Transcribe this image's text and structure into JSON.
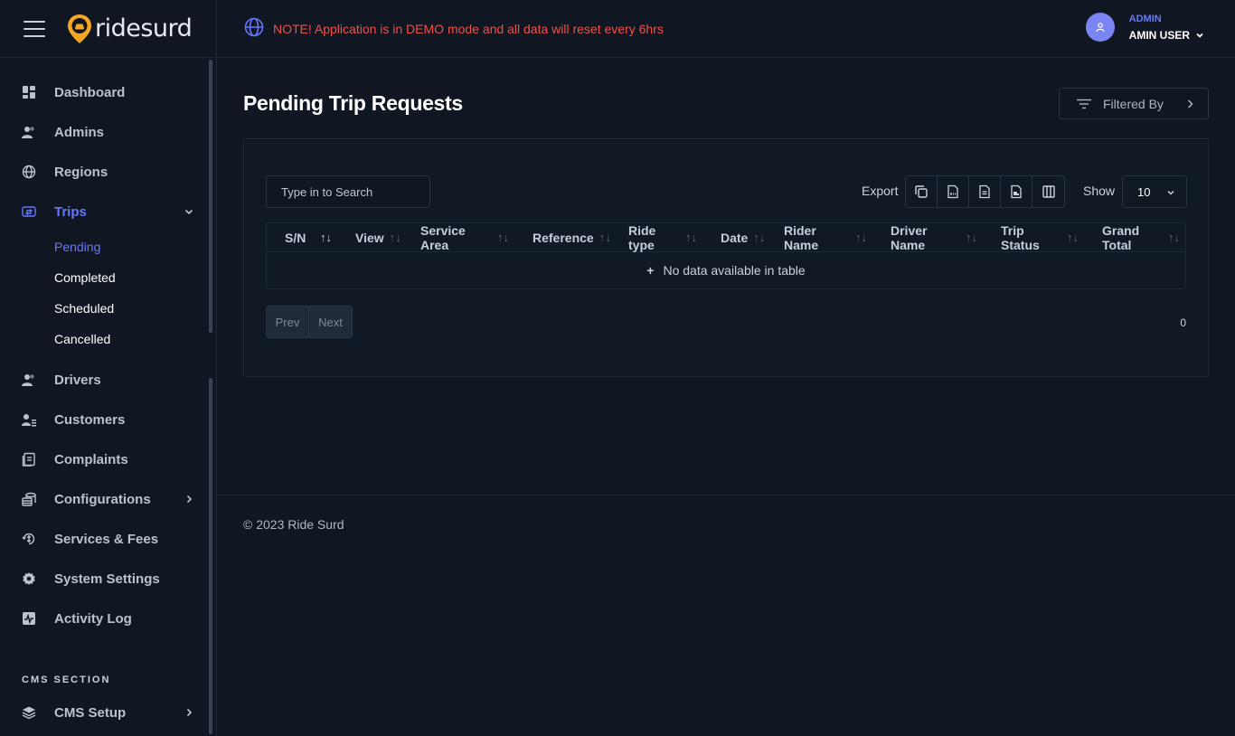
{
  "brand": {
    "name": "ridesurd",
    "accent": "#6677ff",
    "logo_color": "#f5a623"
  },
  "notice": "NOTE! Application is in DEMO mode and all data will reset every 6hrs",
  "user": {
    "role": "ADMIN",
    "name": "AMIN USER"
  },
  "sidebar": {
    "items": [
      {
        "label": "Dashboard",
        "icon": "dashboard-icon"
      },
      {
        "label": "Admins",
        "icon": "users-icon"
      },
      {
        "label": "Regions",
        "icon": "globe-icon"
      },
      {
        "label": "Trips",
        "icon": "trips-icon",
        "expanded": true
      },
      {
        "label": "Drivers",
        "icon": "users-icon"
      },
      {
        "label": "Customers",
        "icon": "customers-icon"
      },
      {
        "label": "Complaints",
        "icon": "document-icon"
      },
      {
        "label": "Configurations",
        "icon": "coins-icon"
      },
      {
        "label": "Services & Fees",
        "icon": "services-icon"
      },
      {
        "label": "System Settings",
        "icon": "gear-icon"
      },
      {
        "label": "Activity Log",
        "icon": "activity-icon"
      }
    ],
    "trip_sub": [
      "Pending",
      "Completed",
      "Scheduled",
      "Cancelled"
    ],
    "cms_section_title": "CMS SECTION",
    "cms_items": [
      {
        "label": "CMS Setup",
        "icon": "layers-icon"
      }
    ]
  },
  "page": {
    "title": "Pending Trip Requests",
    "filter_label": "Filtered By"
  },
  "table_controls": {
    "search_placeholder": "Type in to Search",
    "export_label": "Export",
    "export_buttons": [
      "copy-icon",
      "csv-icon",
      "excel-icon",
      "pdf-icon",
      "columns-icon"
    ],
    "show_label": "Show",
    "show_value": "10"
  },
  "table": {
    "columns": [
      "S/N",
      "View",
      "Service Area",
      "Reference",
      "Ride type",
      "Date",
      "Rider Name",
      "Driver Name",
      "Trip Status",
      "Grand Total"
    ],
    "empty_message": "No data available in table",
    "prev": "Prev",
    "next": "Next",
    "count": "0"
  },
  "footer": {
    "text": "© 2023 Ride Surd"
  }
}
